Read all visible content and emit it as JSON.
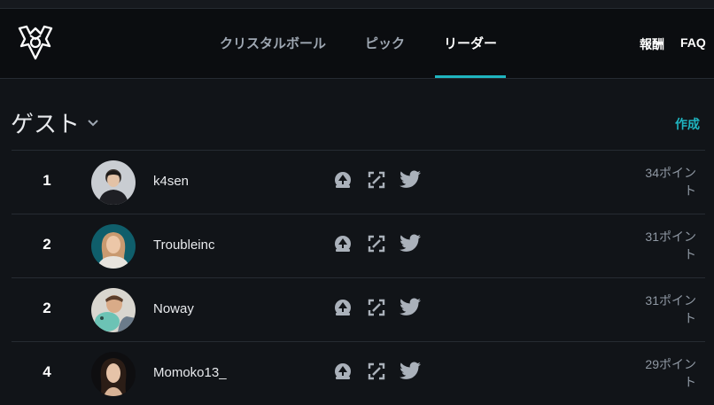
{
  "nav": {
    "links": [
      {
        "label": "クリスタルボール"
      },
      {
        "label": "ピック"
      },
      {
        "label": "リーダー"
      }
    ],
    "rewards": "報酬",
    "faq": "FAQ"
  },
  "header": {
    "title": "ゲスト",
    "create": "作成"
  },
  "leaders": [
    {
      "rank": "1",
      "name": "k4sen",
      "points_line1": "34ポイン",
      "points_line2": "ト"
    },
    {
      "rank": "2",
      "name": "Troubleinc",
      "points_line1": "31ポイン",
      "points_line2": "ト"
    },
    {
      "rank": "2",
      "name": "Noway",
      "points_line1": "31ポイン",
      "points_line2": "ト"
    },
    {
      "rank": "4",
      "name": "Momoko13_",
      "points_line1": "29ポイン",
      "points_line2": "ト"
    }
  ],
  "icons": {
    "logo": "worlds-trophy-logo",
    "dropdown": "chevron-down-icon",
    "row_icons": [
      "stream-icon",
      "expand-icon",
      "twitter-icon"
    ]
  },
  "colors": {
    "background": "#111418",
    "navbar": "#0b0d10",
    "accent": "#1fb5c0",
    "divider": "#262b32",
    "muted_text": "#8f98a3"
  }
}
